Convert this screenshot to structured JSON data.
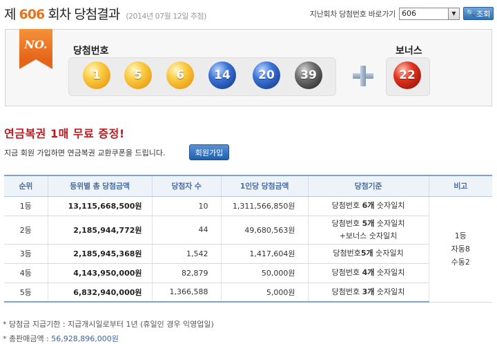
{
  "header": {
    "title_prefix": "제",
    "draw_number": "606",
    "title_suffix": "회차 당첨결과",
    "draw_date": "(2014년 07월 12일 추첨)",
    "jump_label": "지난회차 당첨번호 바로가기",
    "select_value": "606",
    "search_label": "조회"
  },
  "numbers": {
    "ribbon": "NO.",
    "winning_label": "당첨번호",
    "bonus_label": "보너스",
    "balls": [
      {
        "value": "1",
        "color": "#f5b21f"
      },
      {
        "value": "5",
        "color": "#f5b21f"
      },
      {
        "value": "6",
        "color": "#f5b21f"
      },
      {
        "value": "14",
        "color": "#2a5bbf"
      },
      {
        "value": "20",
        "color": "#2a5bbf"
      },
      {
        "value": "39",
        "color": "#555555"
      }
    ],
    "bonus": {
      "value": "22",
      "color": "#d42a17"
    }
  },
  "promo": {
    "title": "연금복권 1매 무료 증정!",
    "text": "지금 회원 가입하면 연금복권 교환쿠폰을 드립니다.",
    "join_button": "회원가입"
  },
  "table": {
    "headers": [
      "순위",
      "등위별 총 당첨금액",
      "당첨자 수",
      "1인당 당첨금액",
      "당첨기준",
      "비고"
    ],
    "rows": [
      {
        "rank": "1등",
        "total": "13,115,668,500원",
        "winners": "10",
        "per": "1,311,566,850원",
        "crit_a": "당첨번호 ",
        "crit_b": "6개",
        "crit_c": " 숫자일치",
        "crit_line2": ""
      },
      {
        "rank": "2등",
        "total": "2,185,944,772원",
        "winners": "44",
        "per": "49,680,563원",
        "crit_a": "당첨번호 ",
        "crit_b": "5개",
        "crit_c": " 숫자일치",
        "crit_line2": "+보너스 숫자일치"
      },
      {
        "rank": "3등",
        "total": "2,185,945,368원",
        "winners": "1,542",
        "per": "1,417,604원",
        "crit_a": "당첨번호",
        "crit_b": "5개",
        "crit_c": " 숫자일치",
        "crit_line2": ""
      },
      {
        "rank": "4등",
        "total": "4,143,950,000원",
        "winners": "82,879",
        "per": "50,000원",
        "crit_a": "당첨번호 ",
        "crit_b": "4개",
        "crit_c": " 숫자일치",
        "crit_line2": ""
      },
      {
        "rank": "5등",
        "total": "6,832,940,000원",
        "winners": "1,366,588",
        "per": "5,000원",
        "crit_a": "당첨번호 ",
        "crit_b": "3개",
        "crit_c": " 숫자일치",
        "crit_line2": ""
      }
    ],
    "note_lines": [
      "1등",
      "자동8",
      "수동2"
    ]
  },
  "footer": {
    "payout_label": "* 당첨금 지급기한 : 지급개시일로부터 1년 (휴일인 경우 익영업일)",
    "sales_label": "* 총판매금액 : ",
    "sales_value": "56,928,896,000원"
  }
}
